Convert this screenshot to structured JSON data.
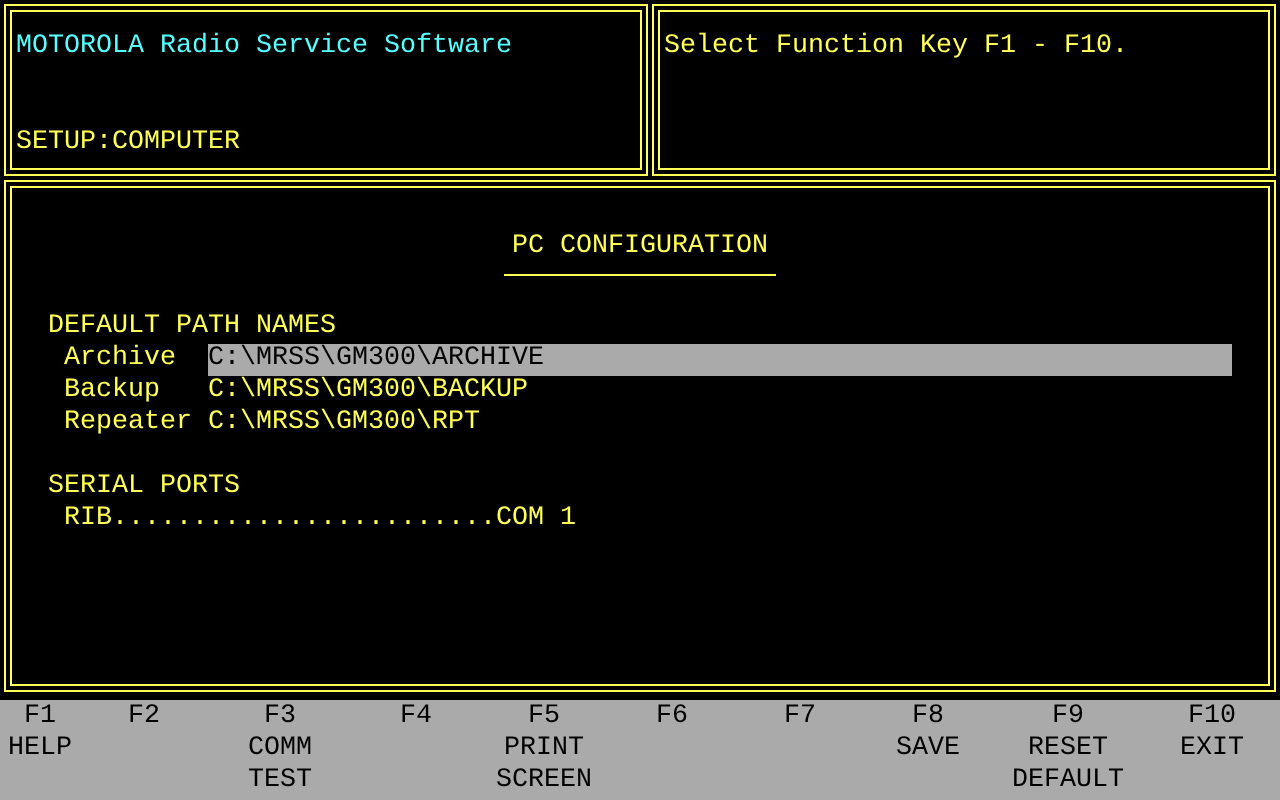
{
  "header": {
    "title": "MOTOROLA Radio Service Software",
    "mode": "SETUP:COMPUTER",
    "prompt": "Select Function Key F1 - F10."
  },
  "screen": {
    "title": "PC CONFIGURATION",
    "path_section": "DEFAULT PATH NAMES",
    "paths": [
      {
        "label": "Archive",
        "value": "C:\\MRSS\\GM300\\ARCHIVE",
        "selected": true
      },
      {
        "label": "Backup",
        "value": "C:\\MRSS\\GM300\\BACKUP",
        "selected": false
      },
      {
        "label": "Repeater",
        "value": "C:\\MRSS\\GM300\\RPT",
        "selected": false
      }
    ],
    "serial_section": "SERIAL PORTS",
    "ports": [
      {
        "text": "RIB........................COM 1"
      }
    ]
  },
  "function_keys": [
    {
      "key": "F1",
      "lines": [
        "HELP"
      ]
    },
    {
      "key": "F2"
    },
    {
      "key": "F3",
      "lines": [
        "COMM",
        "TEST"
      ]
    },
    {
      "key": "F4"
    },
    {
      "key": "F5",
      "lines": [
        "PRINT",
        "SCREEN"
      ]
    },
    {
      "key": "F6"
    },
    {
      "key": "F7"
    },
    {
      "key": "F8",
      "lines": [
        "SAVE"
      ]
    },
    {
      "key": "F9",
      "lines": [
        "RESET",
        "DEFAULT"
      ]
    },
    {
      "key": "F10",
      "lines": [
        "EXIT"
      ]
    }
  ]
}
